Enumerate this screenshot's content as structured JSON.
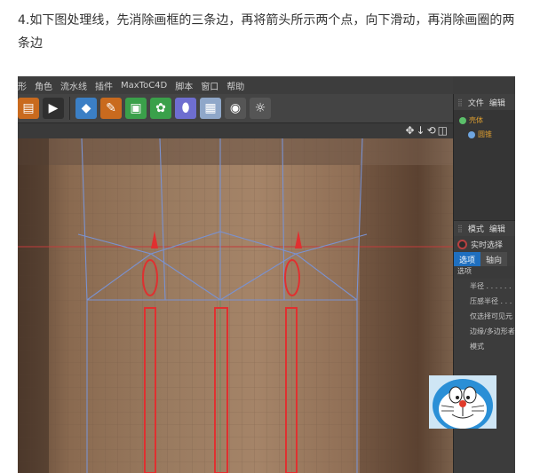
{
  "caption": "4.如下图处理线，先消除画框的三条边，再将箭头所示两个点，向下滑动，再消除画圈的两条边",
  "menu": [
    "形",
    "角色",
    "流水线",
    "插件",
    "MaxToC4D",
    "脚本",
    "窗口",
    "帮助"
  ],
  "toolbar_icons": [
    "render-icon",
    "cube-icon",
    "pen-icon",
    "subdivide-icon",
    "cloner-icon",
    "deformer-icon",
    "floor-icon",
    "camera-icon",
    "light-icon"
  ],
  "viewport_nav": "✥↓⟲◫",
  "object_panel": {
    "tabs": [
      "文件",
      "编辑"
    ],
    "items": [
      "壳体",
      "圆锥"
    ]
  },
  "attribute_panel": {
    "tabs": [
      "模式",
      "编辑"
    ],
    "live_selection": "实时选择",
    "sub_tabs": [
      "选项",
      "轴向"
    ],
    "section": "选项",
    "properties": [
      "半径 . . . . . .",
      "压感半径 . . .",
      "仅选择可见元",
      "边缘/多边形者",
      "模式"
    ]
  },
  "colors": {
    "highlight": "#e03030",
    "wire": "#6f88c8",
    "accent_tab": "#1f6fbf"
  }
}
